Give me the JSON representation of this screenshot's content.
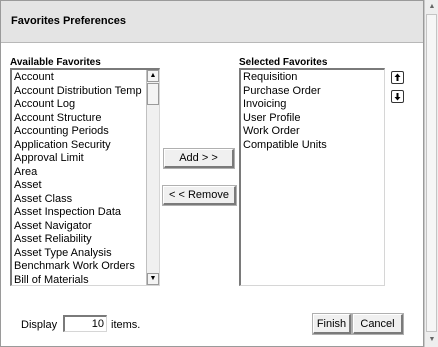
{
  "dialog": {
    "title": "Favorites Preferences"
  },
  "available": {
    "label": "Available Favorites",
    "items": [
      "Account",
      "Account Distribution Temp",
      "Account Log",
      "Account Structure",
      "Accounting Periods",
      "Application Security",
      "Approval Limit",
      "Area",
      "Asset",
      "Asset Class",
      "Asset Inspection Data",
      "Asset Navigator",
      "Asset Reliability",
      "Asset Type Analysis",
      "Benchmark Work Orders",
      "Bill of Materials"
    ]
  },
  "selected": {
    "label": "Selected Favorites",
    "items": [
      "Requisition",
      "Purchase Order",
      "Invoicing",
      "User Profile",
      "Work Order",
      "Compatible Units"
    ]
  },
  "actions": {
    "add_label": "Add > >",
    "remove_label": "< < Remove",
    "finish_label": "Finish",
    "cancel_label": "Cancel"
  },
  "display": {
    "label": "Display",
    "value": "10",
    "suffix": "items."
  },
  "icons": {
    "move_up": "arrow-up-icon",
    "move_down": "arrow-down-icon"
  }
}
